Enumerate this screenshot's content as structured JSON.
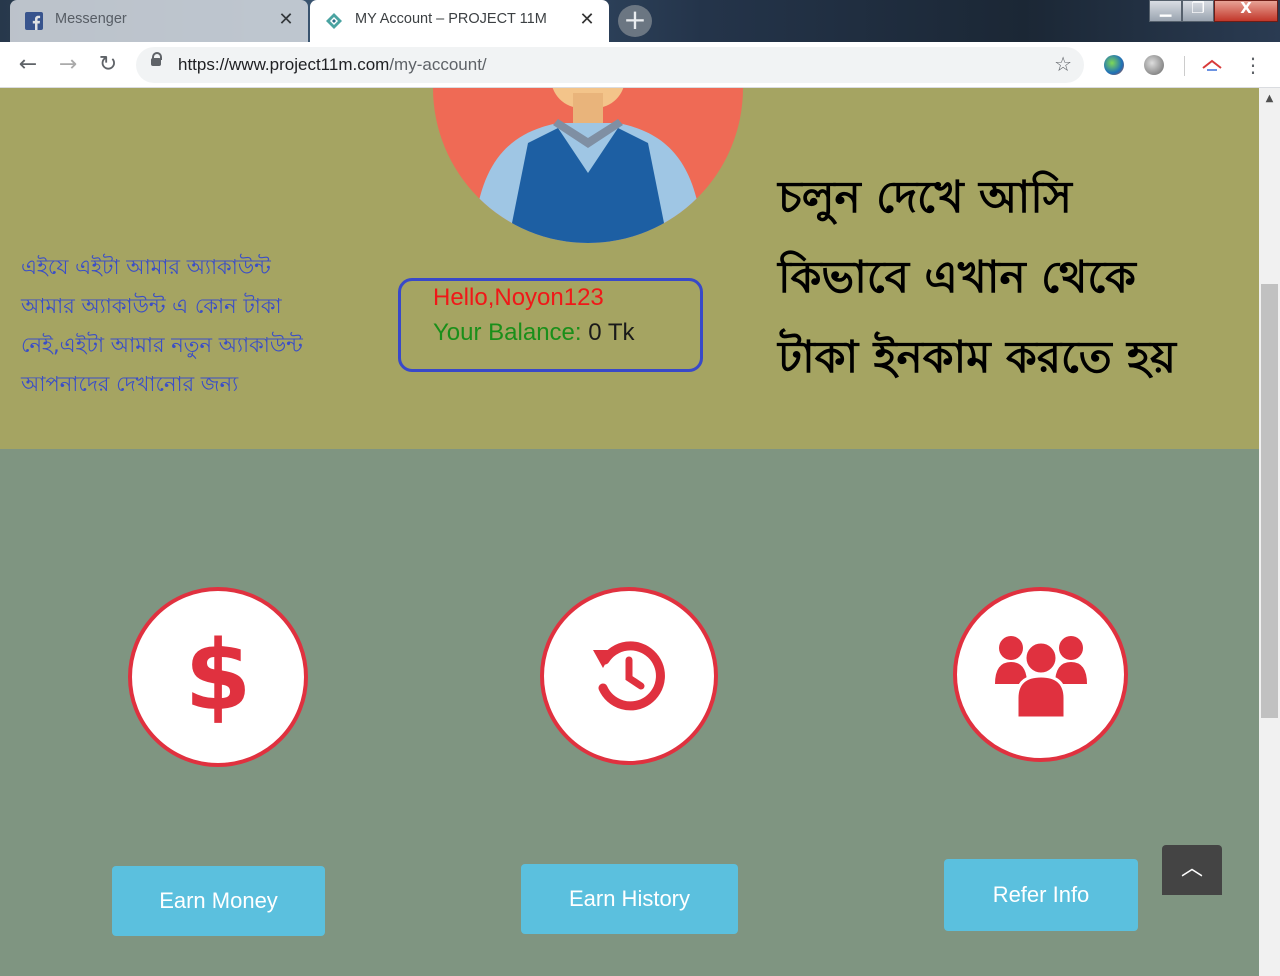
{
  "browser": {
    "tabs": [
      {
        "title": "Messenger",
        "active": false,
        "icon": "facebook-icon"
      },
      {
        "title": "MY Account – PROJECT 11M",
        "active": true,
        "icon": "site-logo-icon"
      }
    ],
    "close_glyph": "✕",
    "new_tab_glyph": "+",
    "window_controls": {
      "minimize": "▁",
      "maximize": "❐",
      "close": "X"
    },
    "nav": {
      "back": "←",
      "forward": "→",
      "reload": "↻"
    },
    "url": {
      "host": "https://www.project11m.com",
      "path": "/my-account/"
    },
    "bookmark_glyph": "☆",
    "menu_glyph": "⋮"
  },
  "hero": {
    "left_text": [
      "এইযে এইটা আমার অ্যাকাউন্ট",
      "আমার অ্যাকাউন্ট এ কোন টাকা",
      "নেই,এইটা আমার নতুন অ্যাকাউন্ট",
      "আপনাদের দেখানোর জন্য"
    ],
    "greeting": "Hello,Noyon123",
    "balance_label": "Your Balance:",
    "balance_value": " 0 Tk",
    "right_heading": [
      "চলুন দেখে আসি",
      "কিভাবে এখান থেকে",
      "টাকা ইনকাম করতে হয়"
    ]
  },
  "actions": [
    {
      "icon": "dollar-icon",
      "label": "Earn Money"
    },
    {
      "icon": "history-icon",
      "label": "Earn History"
    },
    {
      "icon": "users-icon",
      "label": "Refer Info"
    }
  ],
  "scroll_top_glyph": "︿",
  "colors": {
    "hero_bg": "#a5a462",
    "lower_bg": "#7f9581",
    "accent_red": "#e0313f",
    "button_blue": "#5bc0de"
  }
}
